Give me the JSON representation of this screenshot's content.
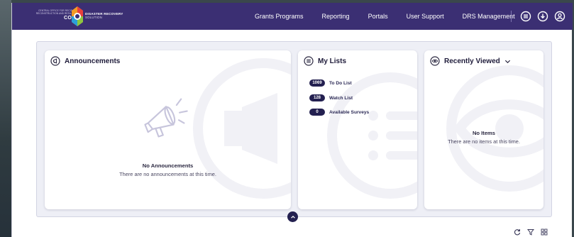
{
  "header": {
    "org_name": "CENTRAL OFFICE FOR RECOVERY, RECONSTRUCTION AND RESILIENCY",
    "org_code": "COR3",
    "brand_line1": "DISASTER RECOVERY",
    "brand_line2": "SOLUTION",
    "bg_color": "#3b2f73"
  },
  "nav": {
    "items": [
      {
        "label": "Grants Programs"
      },
      {
        "label": "Reporting"
      },
      {
        "label": "Portals"
      },
      {
        "label": "User Support"
      },
      {
        "label": "DRS Management"
      }
    ],
    "icons": [
      "menu-circle-icon",
      "download-circle-icon",
      "user-circle-icon"
    ]
  },
  "announcements": {
    "title": "Announcements",
    "icon": "megaphone-circle-icon",
    "empty_title": "No Announcements",
    "empty_text": "There are no announcements at this time."
  },
  "my_lists": {
    "title": "My Lists",
    "icon": "list-circle-icon",
    "items": [
      {
        "count": "1069",
        "label": "To Do List"
      },
      {
        "count": "128",
        "label": "Watch List"
      },
      {
        "count": "0",
        "label": "Available Surveys"
      }
    ]
  },
  "recently_viewed": {
    "title": "Recently Viewed",
    "icon": "eye-icon",
    "empty_title": "No Items",
    "empty_text": "There are no items at this time."
  },
  "toolbar": {
    "icons": [
      "refresh-icon",
      "filter-icon",
      "grid-icon"
    ]
  },
  "colors": {
    "accent": "#232050",
    "dashboard_bg": "#eeeff6"
  }
}
